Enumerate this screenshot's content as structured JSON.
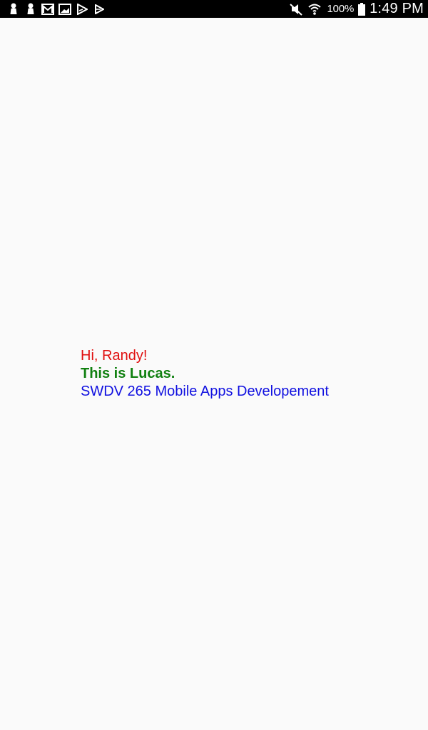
{
  "status_bar": {
    "left_icons": [
      "person-icon",
      "person-icon",
      "mail-icon",
      "image-icon",
      "play-store-icon",
      "play-icon"
    ],
    "right_icons": [
      "mute-icon",
      "wifi-icon",
      "battery-icon"
    ],
    "battery_percent": "100%",
    "time": "1:49 PM"
  },
  "content": {
    "greeting": "Hi, Randy!",
    "intro": "This is Lucas.",
    "course": "SWDV 265 Mobile Apps Developement"
  },
  "colors": {
    "greeting": "#e01010",
    "intro": "#108010",
    "course": "#1010e0",
    "background": "#fafafa",
    "status_bar": "#000000"
  }
}
